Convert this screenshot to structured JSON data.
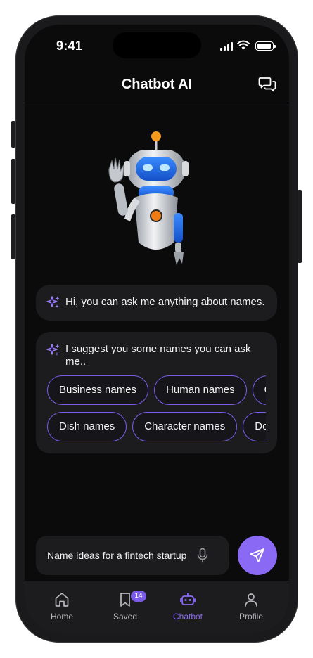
{
  "status_bar": {
    "time": "9:41"
  },
  "header": {
    "title": "Chatbot AI",
    "icon": "chat-bubbles-icon"
  },
  "messages": [
    {
      "text": "Hi, you can ask me anything about names."
    },
    {
      "text": "I suggest you some names you can ask me.."
    }
  ],
  "suggestions": {
    "row1": [
      "Business names",
      "Human names",
      "Game names"
    ],
    "row2": [
      "Dish names",
      "Character names",
      "Domain names"
    ]
  },
  "composer": {
    "value": "Name ideas for a fintech startup",
    "mic_icon": "microphone-icon",
    "send_icon": "send-icon"
  },
  "tabbar": {
    "items": [
      {
        "label": "Home",
        "icon": "home-icon"
      },
      {
        "label": "Saved",
        "icon": "bookmark-icon",
        "badge": "14"
      },
      {
        "label": "Chatbot",
        "icon": "robot-icon",
        "active": true
      },
      {
        "label": "Profile",
        "icon": "user-icon"
      }
    ]
  },
  "colors": {
    "accent": "#8a6af5",
    "background": "#0b0b0c",
    "surface": "#1c1c1f",
    "chip_border": "#7b5ce8"
  }
}
